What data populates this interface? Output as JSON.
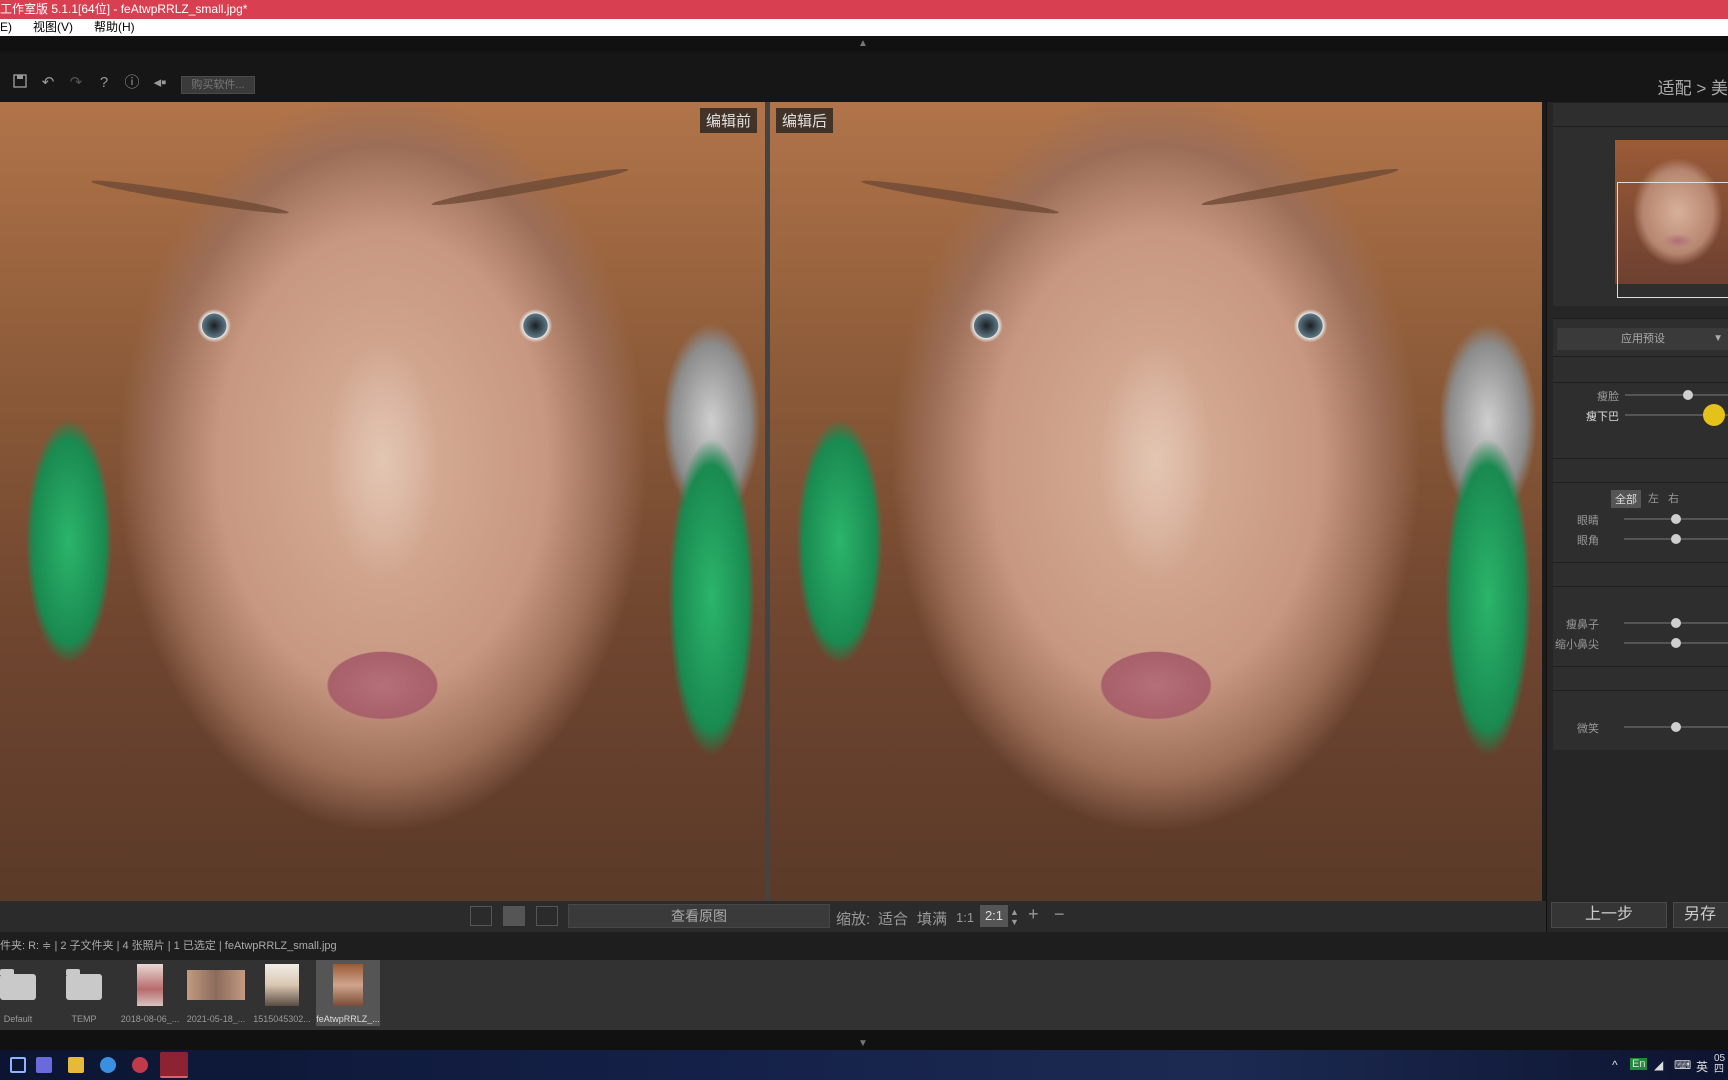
{
  "window": {
    "title": "工作室版 5.1.1[64位] - feAtwpRRLZ_small.jpg*"
  },
  "menu": {
    "items": [
      {
        "label": "E)"
      },
      {
        "label": "视图(V)"
      },
      {
        "label": "帮助(H)"
      }
    ]
  },
  "toolbar": {
    "buy_label": "购买软件...",
    "fit_label": "适配 > 美"
  },
  "viewer": {
    "before_label": "编辑前",
    "after_label": "编辑后"
  },
  "right_panel": {
    "preset_label": "应用预设",
    "face": {
      "sliders": [
        {
          "label": "瘦脸",
          "value": 0.62
        },
        {
          "label": "瘦下巴",
          "value": 0.95
        }
      ]
    },
    "eyes": {
      "segments": [
        "全部",
        "左",
        "右"
      ],
      "active_segment": "全部",
      "sliders": [
        {
          "label": "眼睛",
          "value": 0.5
        },
        {
          "label": "眼角",
          "value": 0.5
        }
      ]
    },
    "nose": {
      "sliders": [
        {
          "label": "瘦鼻子",
          "value": 0.5
        },
        {
          "label": "缩小鼻尖",
          "value": 0.5
        }
      ]
    },
    "mouth": {
      "sliders": [
        {
          "label": "微笑",
          "value": 0.5
        }
      ]
    },
    "prev_button": "上一步",
    "save_button": "另存"
  },
  "bottom_bar": {
    "view_original": "查看原图",
    "zoom_label": "缩放:",
    "fit": "适合",
    "fill": "填满",
    "one_to_one": "1:1",
    "two_to_one": "2:1",
    "plus": "+",
    "minus": "−"
  },
  "status": {
    "text": "件夹: R: ≑ | 2 子文件夹 | 4 张照片 | 1 已选定 | feAtwpRRLZ_small.jpg"
  },
  "filmstrip": {
    "items": [
      {
        "label": "Default",
        "kind": "folder"
      },
      {
        "label": "TEMP",
        "kind": "folder"
      },
      {
        "label": "2018-08-06_...",
        "kind": "photo"
      },
      {
        "label": "2021-05-18_...",
        "kind": "photo"
      },
      {
        "label": "1515045302...",
        "kind": "photo"
      },
      {
        "label": "feAtwpRRLZ_...",
        "kind": "photo",
        "selected": true
      }
    ]
  },
  "taskbar": {
    "ime": "En",
    "lang": "英",
    "clock_top": "05",
    "clock_bottom": "四"
  }
}
